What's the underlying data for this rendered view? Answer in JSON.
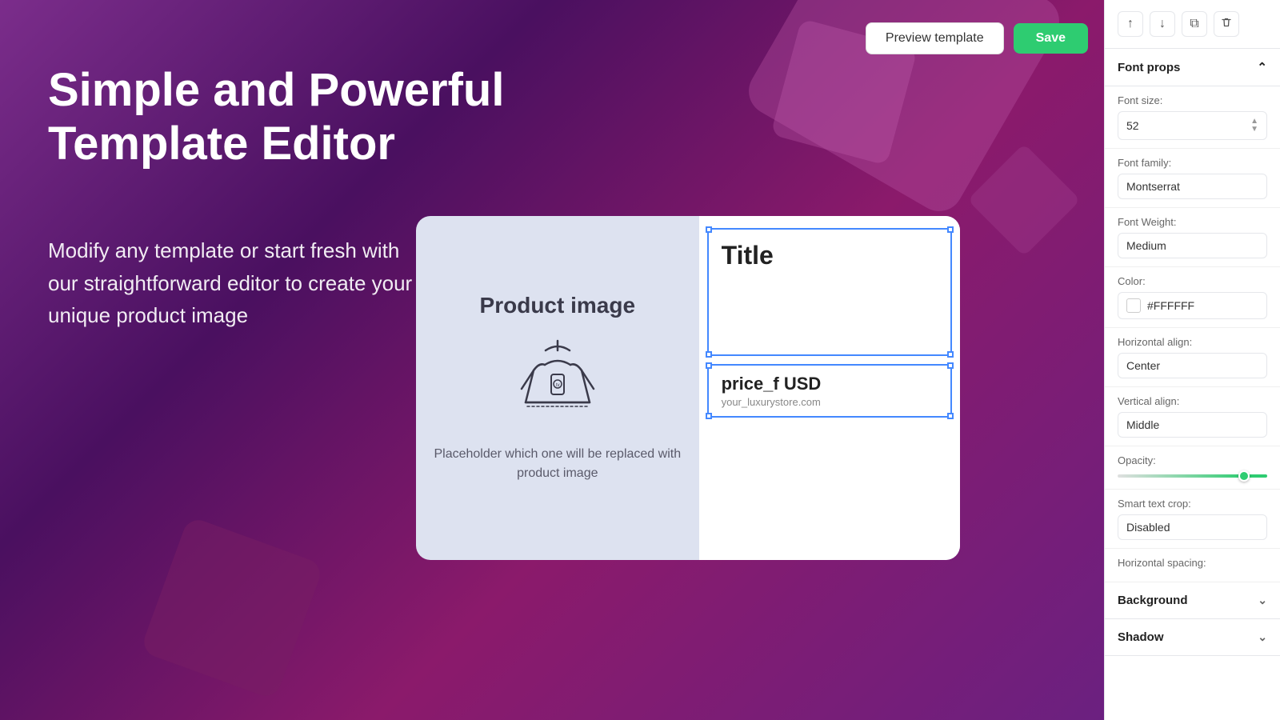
{
  "toolbar": {
    "preview_label": "Preview template",
    "save_label": "Save"
  },
  "hero": {
    "title": "Simple and Powerful Template Editor",
    "subtitle": "Modify any template or start fresh with our straightforward editor to create your unique product image"
  },
  "canvas": {
    "product_image_label": "Product image",
    "product_description": "Placeholder which one will be replaced with product image",
    "title_element": "Title",
    "price_element": "price_f USD",
    "store_url": "your_luxurystore.com"
  },
  "sidebar": {
    "toolbar": {
      "up_icon": "↑",
      "down_icon": "↓",
      "copy_icon": "⧉",
      "delete_icon": "🗑"
    },
    "font_props_label": "Font props",
    "font_size_label": "Font size:",
    "font_size_value": "52",
    "font_family_label": "Font family:",
    "font_family_value": "Montserrat",
    "font_weight_label": "Font Weight:",
    "font_weight_value": "Medium",
    "color_label": "Color:",
    "color_hex": "#FFFFFF",
    "horizontal_align_label": "Horizontal align:",
    "horizontal_align_value": "Center",
    "vertical_align_label": "Vertical align:",
    "vertical_align_value": "Middle",
    "opacity_label": "Opacity:",
    "smart_text_crop_label": "Smart text crop:",
    "smart_text_crop_value": "Disabled",
    "horizontal_spacing_label": "Horizontal spacing:",
    "background_label": "Background",
    "shadow_label": "Shadow"
  }
}
